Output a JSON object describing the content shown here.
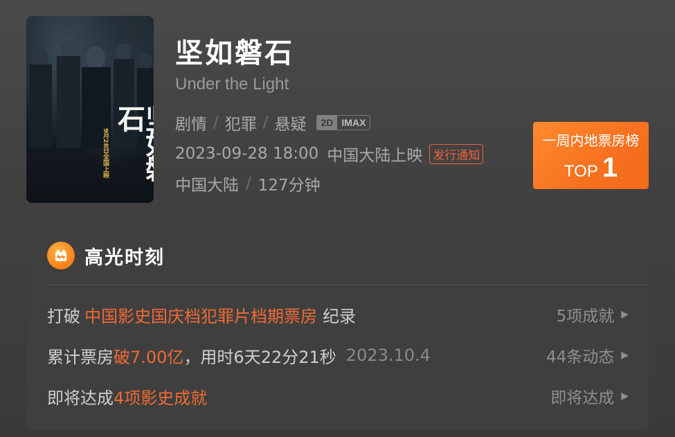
{
  "movie": {
    "title": "坚如磐石",
    "subtitle": "Under the Light",
    "genres": [
      "剧情",
      "犯罪",
      "悬疑"
    ],
    "genre_separator": "/",
    "formats": [
      "2D",
      "IMAX"
    ],
    "release_datetime": "2023-09-28 18:00",
    "release_region_text": "中国大陆上映",
    "release_notice": "发行通知",
    "country": "中国大陆",
    "runtime": "127分钟",
    "poster": {
      "title_calligraphy": "坚如磐石",
      "date_text": "9月28日全国上映"
    }
  },
  "rank": {
    "label": "一周内地票房榜",
    "prefix": "TOP",
    "number": "1"
  },
  "highlights": {
    "title": "高光时刻",
    "rows": [
      {
        "prefix": "打破",
        "highlight": "中国影史国庆档犯罪片档期票房",
        "suffix": "纪录",
        "extra": "",
        "action": "5项成就"
      },
      {
        "prefix": "累计票房",
        "highlight": "破7.00亿",
        "suffix": "，用时6天22分21秒",
        "extra": "2023.10.4",
        "action": "44条动态"
      },
      {
        "prefix": "即将达成",
        "highlight": "4项影史成就",
        "suffix": "",
        "extra": "",
        "action": "即将达成"
      }
    ]
  },
  "colors": {
    "accent": "#f06a35",
    "rank_bg": "#f77120",
    "card_bg": "#3f3f3f"
  }
}
